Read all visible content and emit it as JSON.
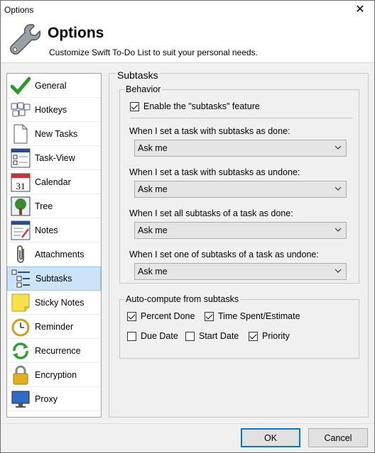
{
  "window": {
    "title": "Options",
    "close_glyph": "✕"
  },
  "header": {
    "title": "Options",
    "subtitle": "Customize Swift To-Do List to suit your personal needs."
  },
  "sidebar": {
    "items": [
      {
        "label": "General",
        "icon": "checkmark-icon"
      },
      {
        "label": "Hotkeys",
        "icon": "keyboard-icon"
      },
      {
        "label": "New Tasks",
        "icon": "document-icon"
      },
      {
        "label": "Task-View",
        "icon": "task-list-icon"
      },
      {
        "label": "Calendar",
        "icon": "calendar-icon",
        "day": "31"
      },
      {
        "label": "Tree",
        "icon": "tree-icon"
      },
      {
        "label": "Notes",
        "icon": "notes-icon"
      },
      {
        "label": "Attachments",
        "icon": "paperclip-icon"
      },
      {
        "label": "Subtasks",
        "icon": "subtasks-icon",
        "selected": true
      },
      {
        "label": "Sticky Notes",
        "icon": "sticky-note-icon"
      },
      {
        "label": "Reminder",
        "icon": "alarm-clock-icon"
      },
      {
        "label": "Recurrence",
        "icon": "recurrence-icon"
      },
      {
        "label": "Encryption",
        "icon": "lock-icon"
      },
      {
        "label": "Proxy",
        "icon": "monitor-icon"
      }
    ]
  },
  "panel": {
    "title": "Subtasks",
    "behavior": {
      "title": "Behavior",
      "enable_label": "Enable the \"subtasks\" feature",
      "enable_checked": true,
      "q1": "When I set a task with subtasks as done:",
      "q1_value": "Ask me",
      "q2": "When I set a task with subtasks as undone:",
      "q2_value": "Ask me",
      "q3": "When I set all subtasks of a task as done:",
      "q3_value": "Ask me",
      "q4": "When I set one of subtasks of a task as undone:",
      "q4_value": "Ask me"
    },
    "autocompute": {
      "title": "Auto-compute from subtasks",
      "percent_done": "Percent Done",
      "time_spent": "Time Spent/Estimate",
      "due_date": "Due Date",
      "start_date": "Start Date",
      "priority": "Priority"
    }
  },
  "footer": {
    "ok": "OK",
    "cancel": "Cancel"
  },
  "colors": {
    "selected_bg": "#cce4f7",
    "accent": "#0078d7"
  }
}
